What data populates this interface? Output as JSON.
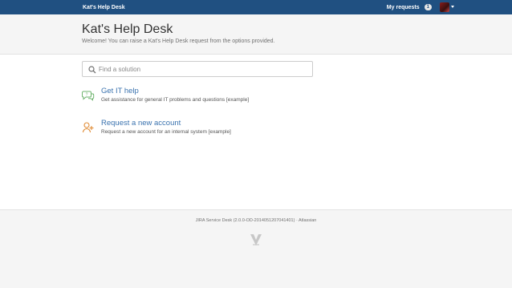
{
  "topbar": {
    "brand": "Kat's Help Desk",
    "my_requests_label": "My requests",
    "my_requests_count": "1"
  },
  "header": {
    "title": "Kat's Help Desk",
    "welcome": "Welcome! You can raise a Kat's Help Desk request from the options provided."
  },
  "search": {
    "placeholder": "Find a solution",
    "icon": "search-icon"
  },
  "options": [
    {
      "title": "Get IT help",
      "description": "Get assistance for general IT problems and questions [example]",
      "icon": "it-help-icon",
      "color": "#6cb36c"
    },
    {
      "title": "Request a new account",
      "description": "Request a new account for an internal system [example]",
      "icon": "add-user-icon",
      "color": "#e08a33"
    }
  ],
  "footer": {
    "text": "JIRA Service Desk (2.0.0-OD-2014051207041401) · Atlassian",
    "logo": "atlassian-logo"
  },
  "colors": {
    "topbar": "#205081",
    "link": "#3b73af"
  }
}
